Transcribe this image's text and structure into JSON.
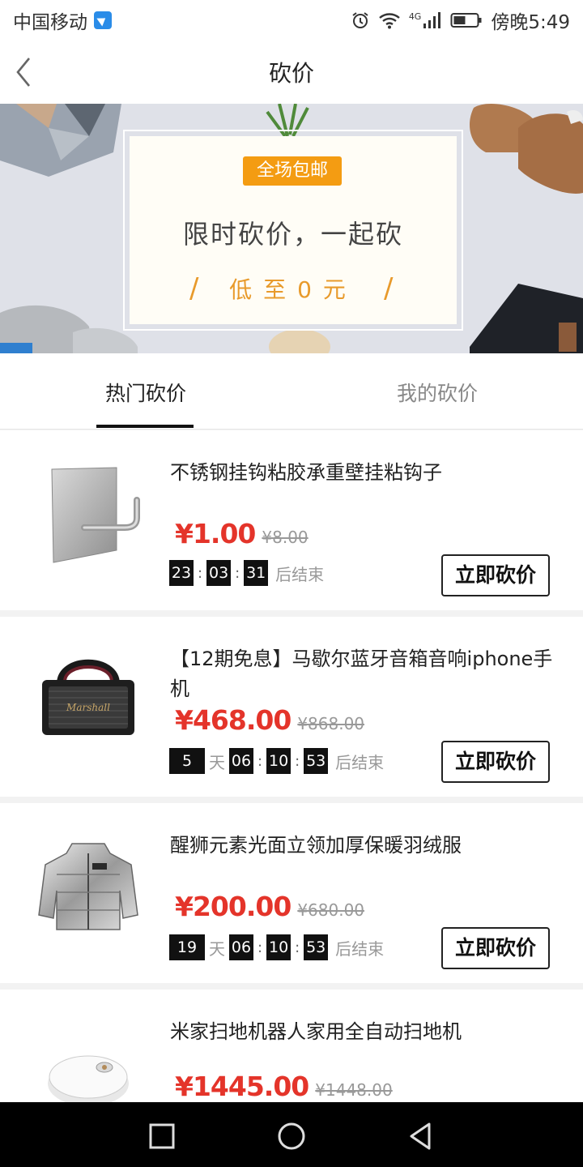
{
  "status_bar": {
    "carrier": "中国移动",
    "network": "4G",
    "time": "傍晚5:49"
  },
  "header": {
    "title": "砍价"
  },
  "banner": {
    "badge": "全场包邮",
    "headline": "限时砍价，一起砍",
    "subline": "低至0元"
  },
  "tabs": [
    {
      "label": "热门砍价",
      "active": true
    },
    {
      "label": "我的砍价",
      "active": false
    }
  ],
  "products": [
    {
      "name": "不锈钢挂钩粘胶承重壁挂粘钩子",
      "price": "¥1.00",
      "original_price": "¥8.00",
      "countdown": {
        "hours": "23",
        "minutes": "03",
        "seconds": "31"
      },
      "end_label": "后结束",
      "button": "立即砍价",
      "icon": "wall-hook-icon"
    },
    {
      "name": "【12期免息】马歇尔蓝牙音箱音响iphone手机",
      "price": "¥468.00",
      "original_price": "¥868.00",
      "countdown": {
        "days": "5",
        "day_unit": "天",
        "hours": "06",
        "minutes": "10",
        "seconds": "53"
      },
      "end_label": "后结束",
      "button": "立即砍价",
      "icon": "speaker-icon"
    },
    {
      "name": "醒狮元素光面立领加厚保暖羽绒服",
      "price": "¥200.00",
      "original_price": "¥680.00",
      "countdown": {
        "days": "19",
        "day_unit": "天",
        "hours": "06",
        "minutes": "10",
        "seconds": "53"
      },
      "end_label": "后结束",
      "button": "立即砍价",
      "icon": "down-jacket-icon"
    },
    {
      "name": "米家扫地机器人家用全自动扫地机",
      "price": "¥1445.00",
      "original_price": "¥1448.00",
      "icon": "robot-vacuum-icon"
    }
  ],
  "colors": {
    "price_red": "#e4342a",
    "banner_orange": "#f49c12",
    "tab_active": "#111111"
  }
}
